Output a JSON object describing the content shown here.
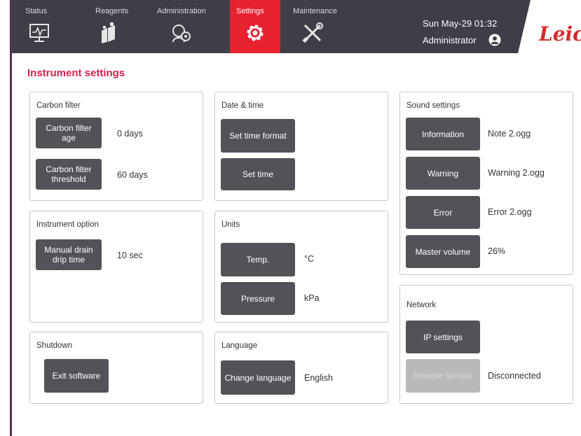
{
  "nav": {
    "tabs": [
      {
        "label": "Status",
        "icon": "monitor-icon"
      },
      {
        "label": "Reagents",
        "icon": "reagent-bottles-icon"
      },
      {
        "label": "Administration",
        "icon": "administration-icon"
      },
      {
        "label": "Settings",
        "icon": "gear-icon",
        "active": true
      },
      {
        "label": "Maintenance",
        "icon": "tools-icon"
      }
    ],
    "datetime": "Sun May-29 01:32",
    "user": "Administrator",
    "logo": "Leica"
  },
  "page": {
    "title": "Instrument settings"
  },
  "carbon_filter": {
    "title": "Carbon filter",
    "age_button": "Carbon filter age",
    "age_value": "0 days",
    "threshold_button": "Carbon filter threshold",
    "threshold_value": "60 days"
  },
  "instrument_option": {
    "title": "Instrument option",
    "drip_button": "Manual drain drip time",
    "drip_value": "10 sec"
  },
  "shutdown": {
    "title": "Shutdown",
    "exit_button": "Exit software"
  },
  "datetime_panel": {
    "title": "Date & time",
    "format_button": "Set time format",
    "set_button": "Set time"
  },
  "units": {
    "title": "Units",
    "temp_button": "Temp.",
    "temp_value": "°C",
    "pressure_button": "Pressure",
    "pressure_value": "kPa"
  },
  "language": {
    "title": "Language",
    "change_button": "Change language",
    "value": "English"
  },
  "sound": {
    "title": "Sound settings",
    "information_button": "Information",
    "information_value": "Note 2.ogg",
    "warning_button": "Warning",
    "warning_value": "Warning 2.ogg",
    "error_button": "Error",
    "error_value": "Error 2.ogg",
    "volume_button": "Master volume",
    "volume_value": "26%"
  },
  "network": {
    "title": "Network",
    "ip_button": "IP settings",
    "remote_button": "Remote Service",
    "remote_status": "Disconnected"
  },
  "colors": {
    "topbar": "#3f3d47",
    "active_tab": "#e8212f",
    "button": "#545258",
    "title": "#d3214f",
    "logo": "#d52b2d"
  }
}
